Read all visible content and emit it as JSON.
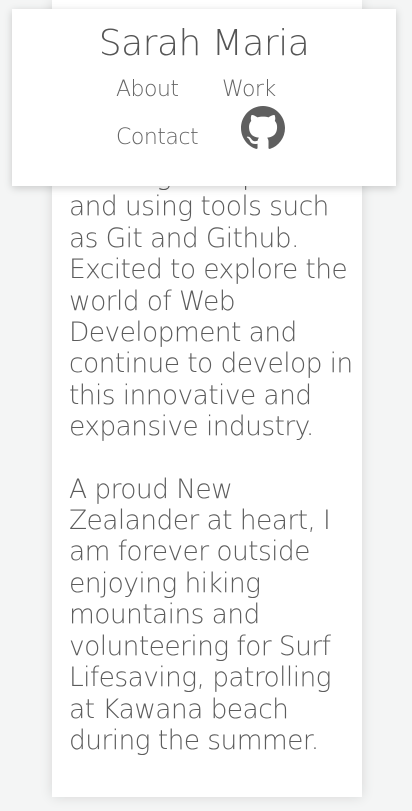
{
  "header": {
    "title": "Sarah Maria",
    "nav": {
      "about": "About",
      "work": "Work",
      "contact": "Contact",
      "github_icon": "github-icon"
    }
  },
  "content": {
    "paragraph_1": "learning best practices and using tools such as Git and Github. Excited to explore the world of Web Development and continue to develop in this innovative and expansive industry.",
    "paragraph_2": "A proud New Zealander at heart, I am forever outside enjoying hiking mountains and volunteering for Surf Lifesaving, patrolling at Kawana beach during the summer."
  },
  "colors": {
    "background": "#f4f5f5",
    "card": "#ffffff",
    "text": "#5c5c5c"
  }
}
